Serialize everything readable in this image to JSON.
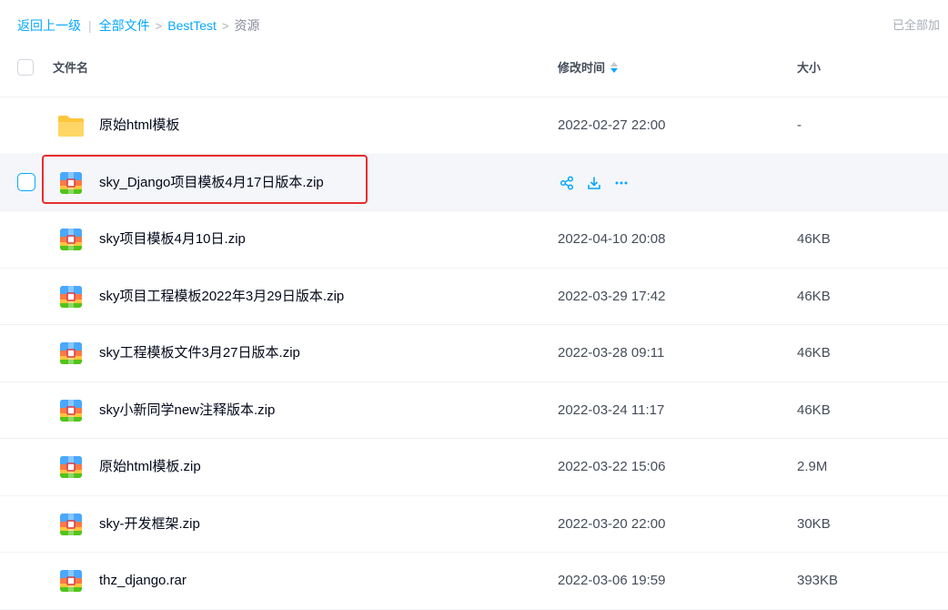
{
  "breadcrumb": {
    "back": "返回上一级",
    "separator": "|",
    "all_files": "全部文件",
    "folder": "BestTest",
    "current": "资源",
    "arrow": ">"
  },
  "status": {
    "loaded": "已全部加"
  },
  "table": {
    "headers": {
      "name": "文件名",
      "time": "修改时间",
      "size": "大小"
    },
    "rows": [
      {
        "name": "原始html模板",
        "time": "2022-02-27 22:00",
        "size": "-",
        "type": "folder"
      },
      {
        "name": "sky_Django项目模板4月17日版本.zip",
        "time": "",
        "size": "",
        "type": "zip",
        "hovered": true
      },
      {
        "name": "sky项目模板4月10日.zip",
        "time": "2022-04-10 20:08",
        "size": "46KB",
        "type": "zip"
      },
      {
        "name": "sky项目工程模板2022年3月29日版本.zip",
        "time": "2022-03-29 17:42",
        "size": "46KB",
        "type": "zip"
      },
      {
        "name": "sky工程模板文件3月27日版本.zip",
        "time": "2022-03-28 09:11",
        "size": "46KB",
        "type": "zip"
      },
      {
        "name": "sky小新同学new注释版本.zip",
        "time": "2022-03-24 11:17",
        "size": "46KB",
        "type": "zip"
      },
      {
        "name": "原始html模板.zip",
        "time": "2022-03-22 15:06",
        "size": "2.9M",
        "type": "zip"
      },
      {
        "name": "sky-开发框架.zip",
        "time": "2022-03-20 22:00",
        "size": "30KB",
        "type": "zip"
      },
      {
        "name": "thz_django.rar",
        "time": "2022-03-06 19:59",
        "size": "393KB",
        "type": "rar"
      }
    ]
  },
  "row_action_icons": [
    "share-icon",
    "download-icon",
    "more-icon"
  ],
  "colors": {
    "accent": "#06a7ff",
    "highlight": "#e62e2e",
    "folder": "#ffd23f"
  }
}
